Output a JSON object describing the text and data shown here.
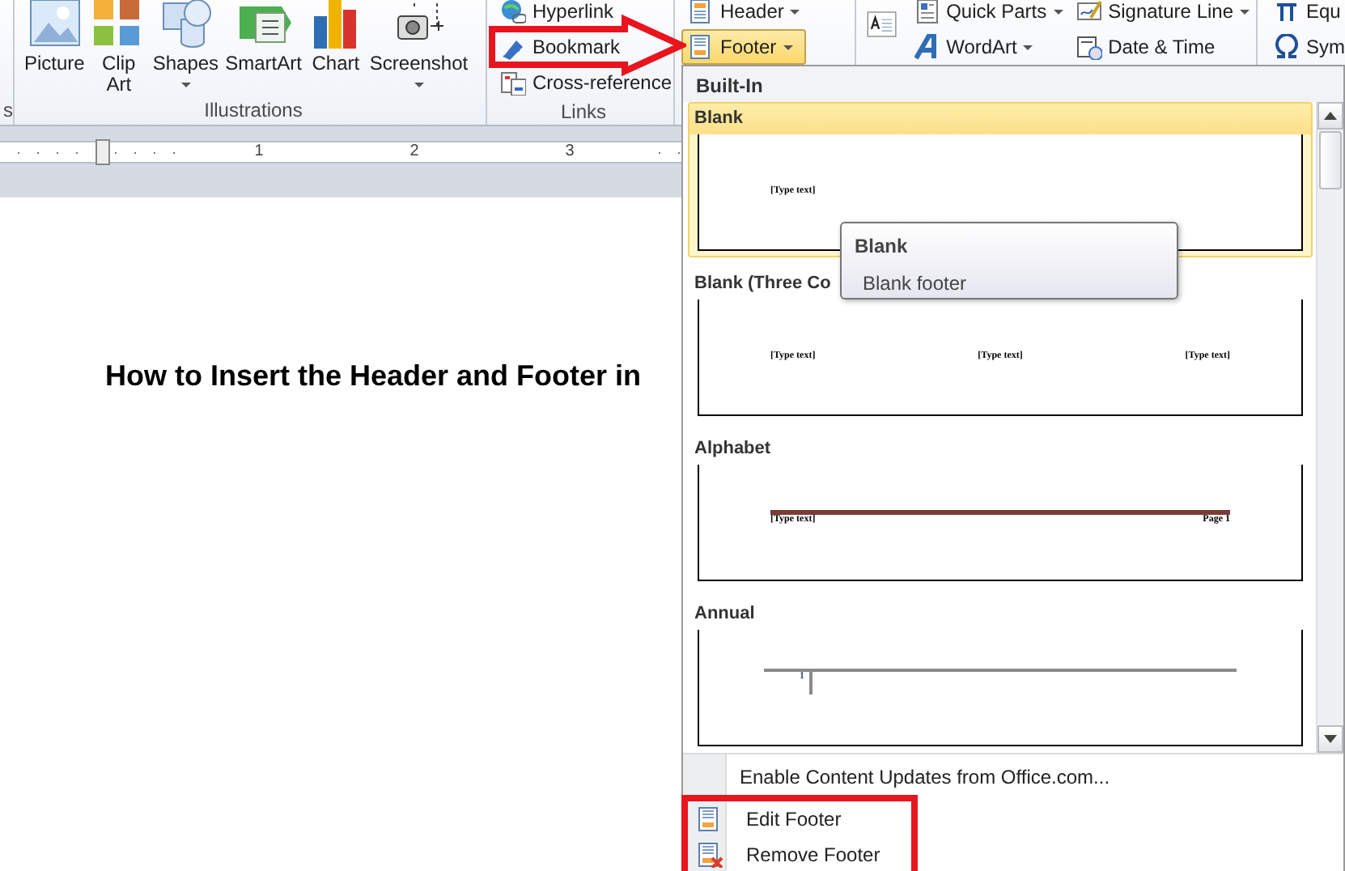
{
  "ribbon": {
    "partial_group": {
      "label": "s"
    },
    "illustrations": {
      "label": "Illustrations",
      "buttons": [
        {
          "label": "Picture",
          "has_menu": false
        },
        {
          "label": "Clip Art",
          "has_menu": false
        },
        {
          "label": "Shapes",
          "has_menu": true
        },
        {
          "label": "SmartArt",
          "has_menu": false
        },
        {
          "label": "Chart",
          "has_menu": false
        },
        {
          "label": "Screenshot",
          "has_menu": true
        }
      ]
    },
    "links": {
      "label": "Links",
      "buttons": [
        {
          "label": "Hyperlink"
        },
        {
          "label": "Bookmark"
        },
        {
          "label": "Cross-reference"
        }
      ]
    },
    "header_footer": {
      "buttons": [
        {
          "label": "Header",
          "has_menu": true,
          "selected": false
        },
        {
          "label": "Footer",
          "has_menu": true,
          "selected": true
        }
      ]
    },
    "text": {
      "buttons": [
        {
          "label": "Quick Parts",
          "has_menu": true
        },
        {
          "label": "WordArt",
          "has_menu": true
        },
        {
          "label": "Signature Line",
          "has_menu": true
        },
        {
          "label": "Date & Time",
          "has_menu": false
        }
      ]
    },
    "symbols": {
      "buttons": [
        {
          "label": "Equ"
        },
        {
          "label": "Sym"
        }
      ]
    }
  },
  "ruler": {
    "marks": [
      "1",
      "2",
      "3"
    ]
  },
  "document": {
    "heading": "How to Insert the Header and Footer in"
  },
  "footer_menu": {
    "section": "Built-In",
    "gallery": [
      {
        "name": "Blank",
        "kind": "blank",
        "selected": true,
        "texts": [
          "[Type text]"
        ]
      },
      {
        "name": "Blank (Three Co",
        "kind": "three_columns",
        "selected": false,
        "texts": [
          "[Type text]",
          "[Type text]",
          "[Type text]"
        ]
      },
      {
        "name": "Alphabet",
        "kind": "alphabet",
        "selected": false,
        "texts": [
          "[Type text]",
          "Page 1"
        ]
      },
      {
        "name": "Annual",
        "kind": "annual",
        "selected": false,
        "texts": [
          "1"
        ]
      }
    ],
    "tooltip": {
      "title": "Blank",
      "description": "Blank footer"
    },
    "commands": [
      {
        "label": "Enable Content Updates from Office.com...",
        "highlighted": false
      },
      {
        "label": "Edit Footer",
        "highlighted": true
      },
      {
        "label": "Remove Footer",
        "highlighted": true
      }
    ]
  }
}
